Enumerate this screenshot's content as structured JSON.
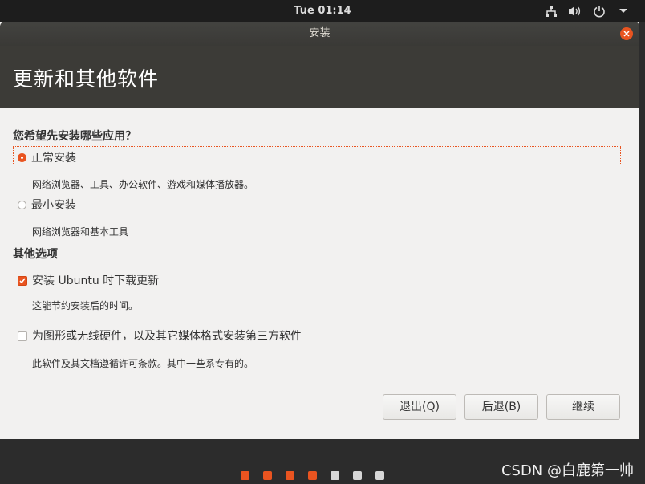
{
  "top_panel": {
    "clock": "Tue 01:14"
  },
  "window": {
    "title": "安装"
  },
  "page": {
    "title": "更新和其他软件"
  },
  "question": "您希望先安装哪些应用？",
  "options": {
    "normal": {
      "label": "正常安装",
      "desc": "网络浏览器、工具、办公软件、游戏和媒体播放器。",
      "selected": true
    },
    "minimal": {
      "label": "最小安装",
      "desc": "网络浏览器和基本工具",
      "selected": false
    }
  },
  "other_section": {
    "title": "其他选项"
  },
  "checkboxes": {
    "updates": {
      "label": "安装 Ubuntu 时下载更新",
      "desc": "这能节约安装后的时间。",
      "checked": true
    },
    "third_party": {
      "label": "为图形或无线硬件，以及其它媒体格式安装第三方软件",
      "desc": "此软件及其文档遵循许可条款。其中一些系专有的。",
      "checked": false
    }
  },
  "buttons": {
    "quit": "退出(Q)",
    "back": "后退(B)",
    "continue": "继续"
  },
  "progress": {
    "done_color": "#e95420",
    "todo_color": "#d7d7d7",
    "steps": 7,
    "completed": 4
  },
  "watermark": "CSDN @白鹿第一帅"
}
